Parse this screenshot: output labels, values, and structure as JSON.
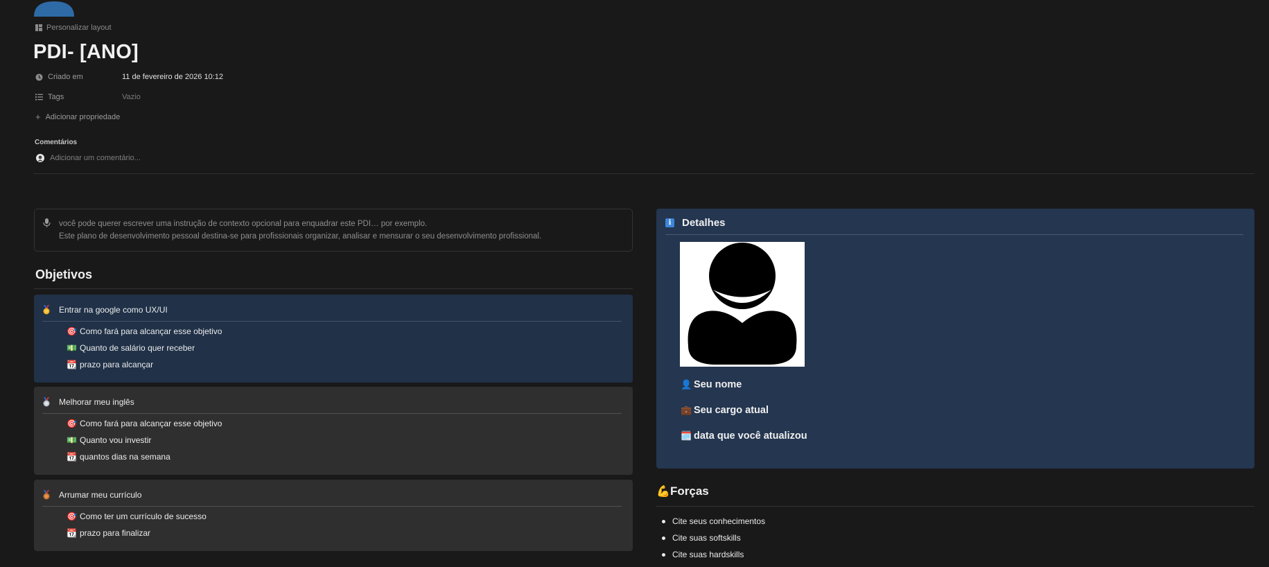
{
  "header": {
    "customize_label": "Personalizar layout",
    "title": "PDI- [ANO]"
  },
  "properties": {
    "created": {
      "label": "Criado em",
      "value": "11 de fevereiro de 2026 10:12"
    },
    "tags": {
      "label": "Tags",
      "value": "Vazio"
    },
    "add_property": "Adicionar propriedade"
  },
  "comments": {
    "heading": "Comentários",
    "placeholder": "Adicionar um comentário..."
  },
  "callout": {
    "line1": "você pode querer escrever uma instrução de contexto opcional para enquadrar este PDI… por exemplo.",
    "line2": "Este plano de desenvolvimento pessoal destina-se  para profissionais organizar, analisar e mensurar o seu desenvolvimento profissional."
  },
  "objectives": {
    "title": "Objetivos",
    "goals": [
      {
        "title": "Entrar na google como UX/UI",
        "items": [
          "Como fará para alcançar esse objetivo",
          "Quanto de salário quer receber",
          "prazo para alcançar"
        ]
      },
      {
        "title": "Melhorar meu inglês",
        "items": [
          "Como fará para alcançar esse objetivo",
          "Quanto vou investir",
          "quantos dias na semana"
        ]
      },
      {
        "title": "Arrumar meu currículo",
        "items": [
          "Como ter um currículo de sucesso",
          "prazo para finalizar"
        ]
      }
    ]
  },
  "details": {
    "title": "Detalhes",
    "name": "Seu nome",
    "role": "Seu cargo atual",
    "updated": "data que você atualizou"
  },
  "forces": {
    "title": "Forças",
    "items": [
      "Cite seus conhecimentos",
      "Cite suas softskills",
      "Cite suas hardskills"
    ]
  },
  "icons": {
    "medals": [
      "gold-medal-icon",
      "silver-medal-icon",
      "bronze-medal-icon"
    ],
    "target": "target-icon",
    "money": "money-icon",
    "calendar": "calendar-icon",
    "person": "person-icon",
    "briefcase": "briefcase-icon",
    "flex": "flexed-biceps-icon"
  },
  "colors": {
    "background": "#191919",
    "goal_blue": "#203148",
    "goal_gray": "#2f2f2f",
    "details_bg": "#243650"
  }
}
